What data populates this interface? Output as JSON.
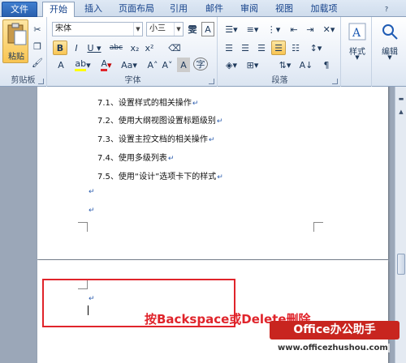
{
  "tabs": [
    "文件",
    "开始",
    "插入",
    "页面布局",
    "引用",
    "邮件",
    "审阅",
    "视图",
    "加载项"
  ],
  "ribbon": {
    "clipboard": {
      "paste_label": "粘贴",
      "group_label": "剪贴板"
    },
    "font": {
      "font_name": "宋体",
      "font_size": "小三",
      "group_label": "字体"
    },
    "paragraph": {
      "group_label": "段落"
    },
    "styles": {
      "label": "样式"
    },
    "editing": {
      "label": "编辑"
    }
  },
  "document": {
    "toc_lines": [
      "7.1、设置样式的相关操作",
      "7.2、使用大纲视图设置标题级别",
      "7.3、设置主控文档的相关操作",
      "7.4、使用多级列表",
      "7.5、使用“设计”选项卡下的样式"
    ],
    "para_mark": "↵"
  },
  "annotation": {
    "text": "按Backspace或Delete删除",
    "watermark": "Office办公助手",
    "watermark_url": "www.officezhushou.com"
  },
  "colors": {
    "accent": "#e0242b",
    "ribbon_tab": "#2a5fae"
  }
}
